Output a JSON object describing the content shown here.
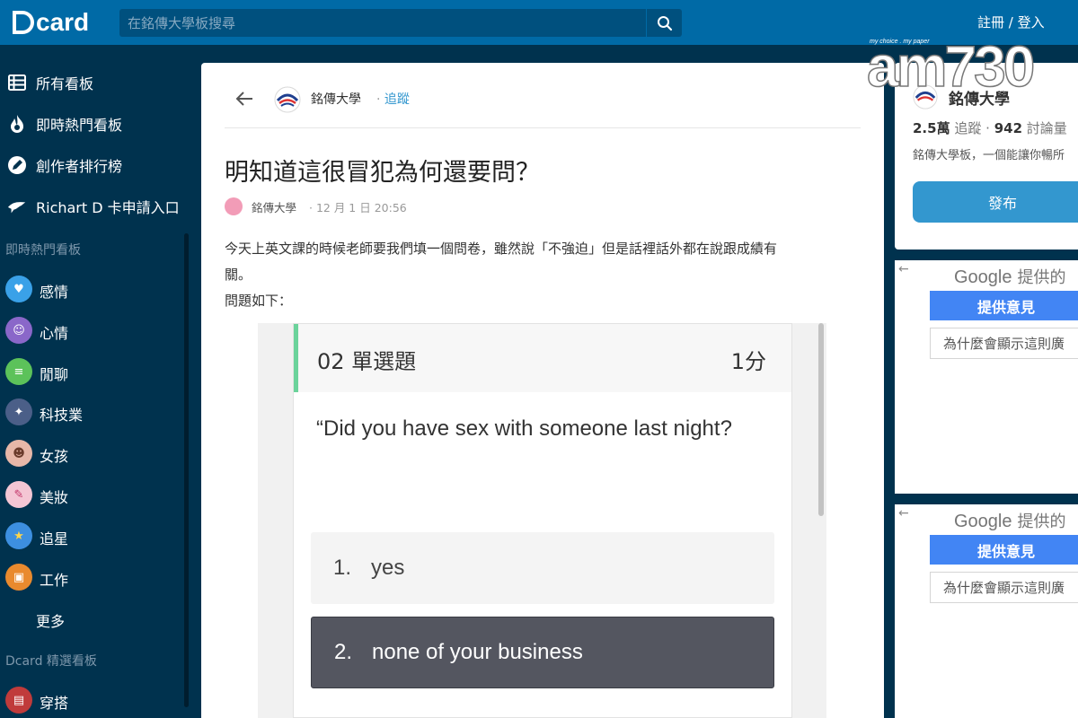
{
  "header": {
    "logo_text": "card",
    "search_placeholder": "在銘傳大學板搜尋",
    "auth_label": "註冊 / 登入"
  },
  "sidebar": {
    "nav": [
      {
        "label": "所有看板",
        "icon": "list-icon"
      },
      {
        "label": "即時熱門看板",
        "icon": "fire-icon"
      },
      {
        "label": "創作者排行榜",
        "icon": "pencil-badge-icon"
      },
      {
        "label": "Richart D 卡申請入口",
        "icon": "bird-icon"
      }
    ],
    "hot_section_title": "即時熱門看板",
    "hot_boards": [
      {
        "label": "感情",
        "color": "#3aa1e8"
      },
      {
        "label": "心情",
        "color": "#8a67c9"
      },
      {
        "label": "閒聊",
        "color": "#5cc25a"
      },
      {
        "label": "科技業",
        "color": "#4b5f88"
      },
      {
        "label": "女孩",
        "color": "#e7b7a8"
      },
      {
        "label": "美妝",
        "color": "#f4c6d4"
      },
      {
        "label": "追星",
        "color": "#3d8fe0"
      },
      {
        "label": "工作",
        "color": "#e98a2e"
      }
    ],
    "more_label": "更多",
    "featured_section_title": "Dcard 精選看板",
    "featured_boards": [
      {
        "label": "穿搭",
        "color": "#c03b3b"
      }
    ]
  },
  "post": {
    "board_name": "銘傳大學",
    "follow_label": "追蹤",
    "title": "明知道這很冒犯為何還要問？",
    "author": "銘傳大學",
    "time": "12 月 1 日 20:56",
    "body_line1": "今天上英文課的時候老師要我們填一個問卷，雖然說「不強迫」但是話裡話外都在說跟成績有",
    "body_line2": "關。",
    "body_line3": "問題如下："
  },
  "embedded_question": {
    "number_label": "02 單選題",
    "score_label": "1分",
    "question": "“Did you have sex with someone last night?",
    "options": [
      {
        "num": "1.",
        "text": "yes"
      },
      {
        "num": "2.",
        "text": "none of your business"
      }
    ]
  },
  "board_info": {
    "name": "銘傳大學",
    "followers_num": "2.5萬",
    "followers_label": "追蹤",
    "discussions_num": "942",
    "discussions_label": "討論量",
    "description": "銘傳大學板，一個能讓你暢所",
    "post_button": "發布"
  },
  "ads": [
    {
      "brand": "Google",
      "rest": "提供的",
      "feedback": "提供意見",
      "why": "為什麼會顯示這則廣"
    },
    {
      "brand": "Google",
      "rest": "提供的",
      "feedback": "提供意見",
      "why": "為什麼會顯示這則廣"
    }
  ],
  "watermark": {
    "tagline": "my choice . my paper",
    "text": "am730"
  }
}
